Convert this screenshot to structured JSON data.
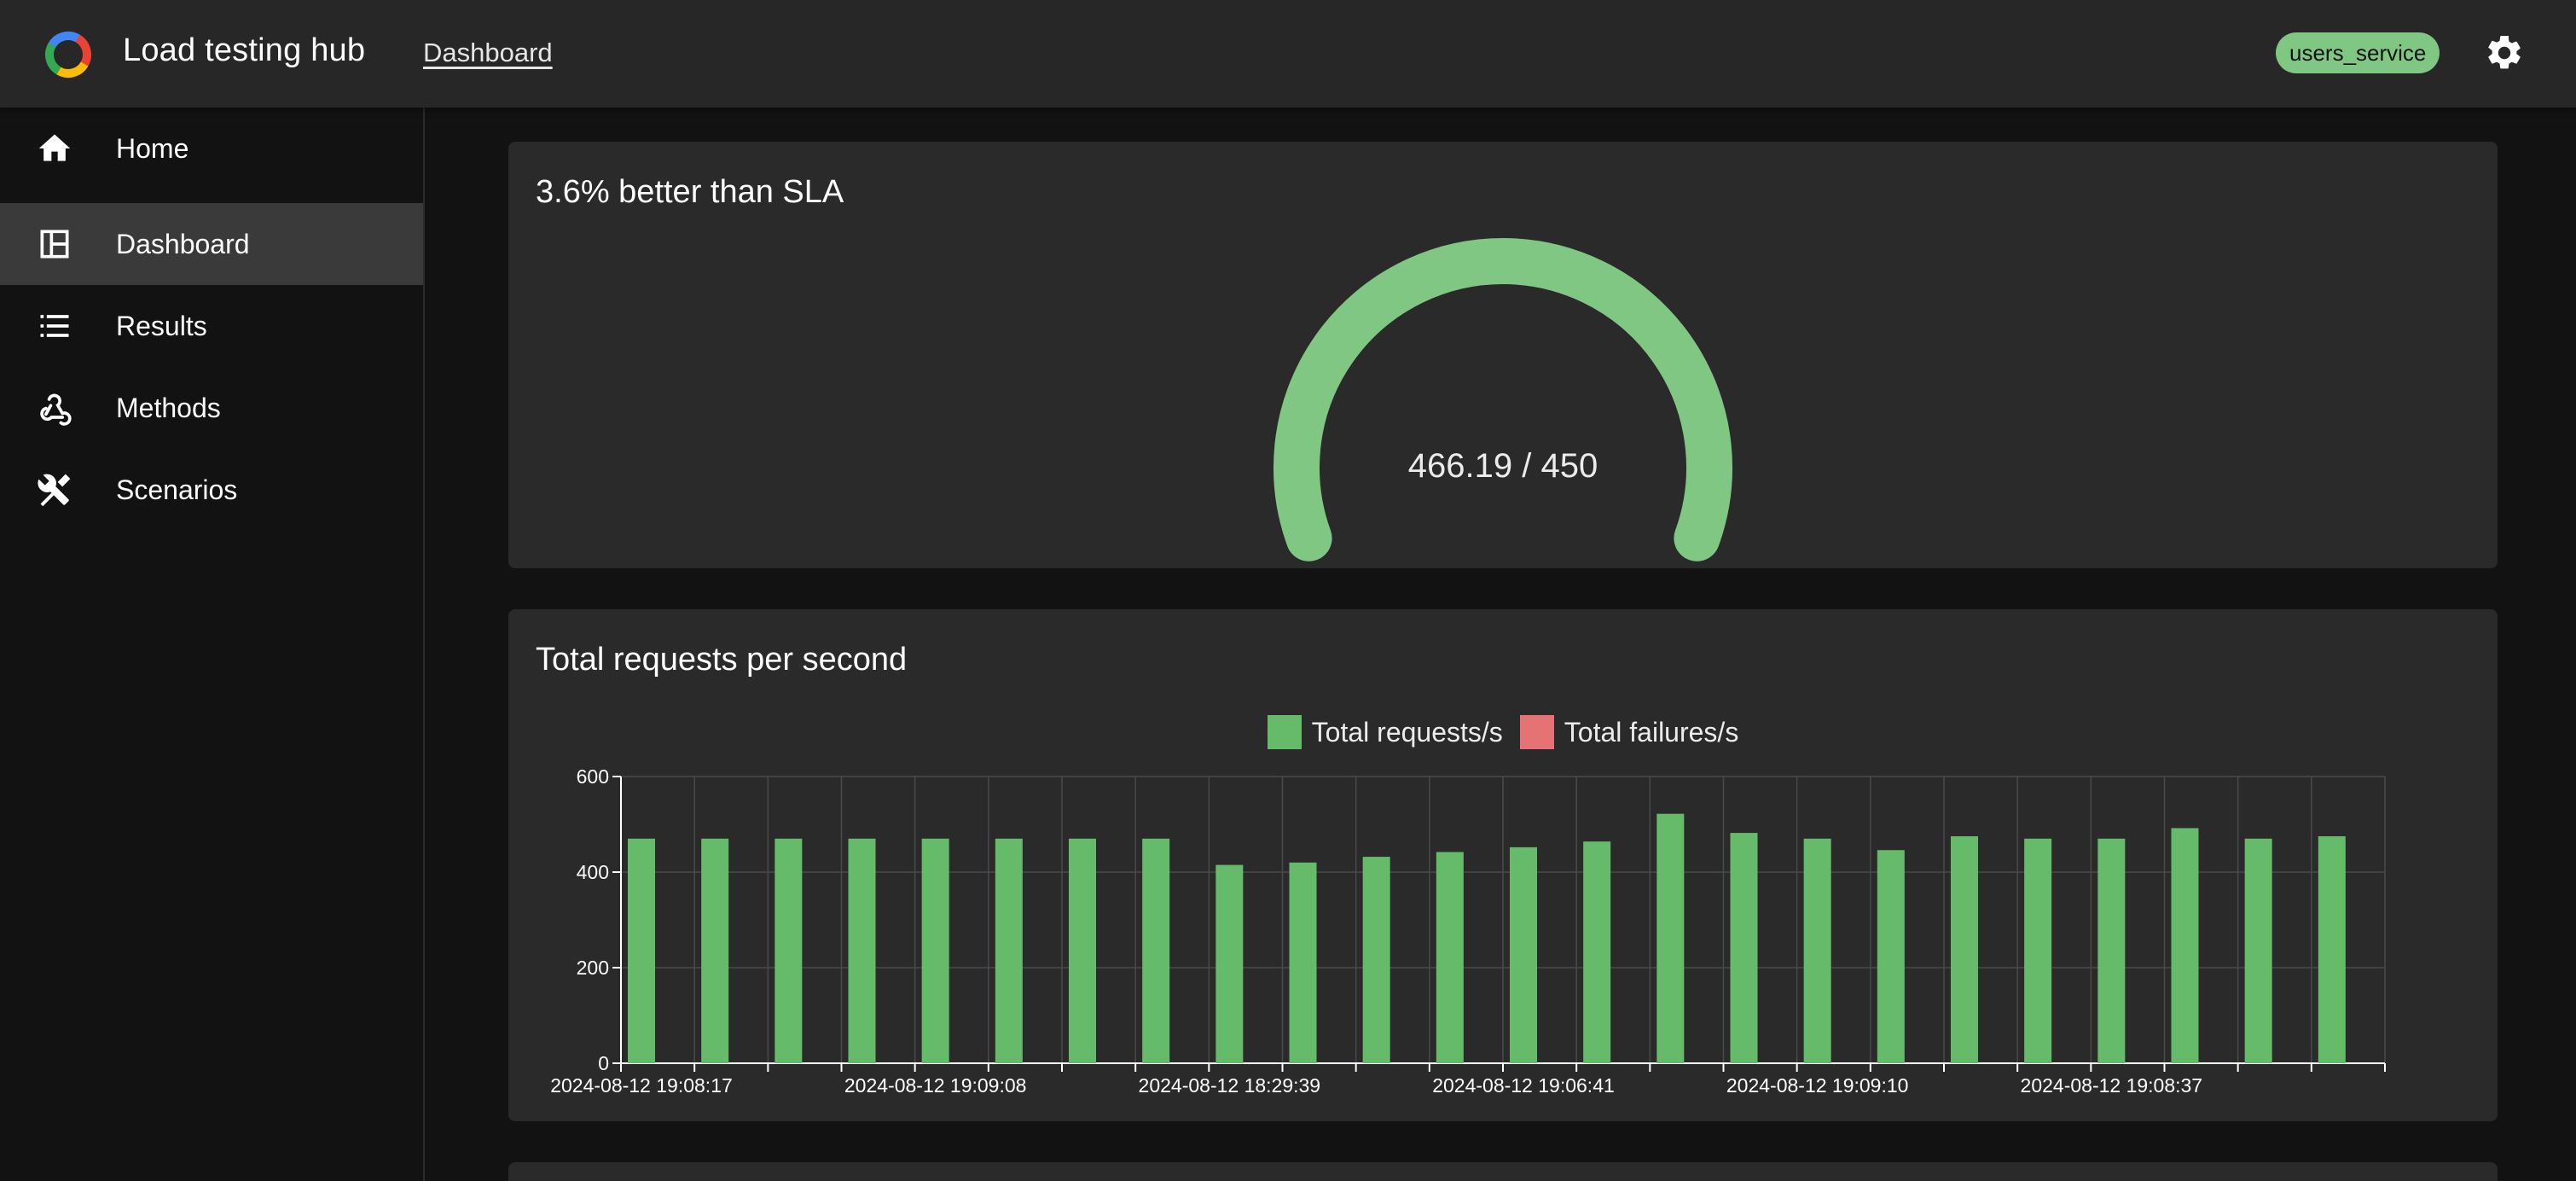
{
  "header": {
    "app_title": "Load testing hub",
    "breadcrumb": "Dashboard",
    "service_badge": "users_service",
    "logo_icon": "google-colors-ring-icon",
    "settings_icon": "gear-icon"
  },
  "sidebar": {
    "items": [
      {
        "label": "Home",
        "icon": "home-icon",
        "active": false
      },
      {
        "label": "Dashboard",
        "icon": "dashboard-icon",
        "active": true
      },
      {
        "label": "Results",
        "icon": "list-icon",
        "active": false
      },
      {
        "label": "Methods",
        "icon": "webhook-icon",
        "active": false
      },
      {
        "label": "Scenarios",
        "icon": "tools-icon",
        "active": false
      }
    ]
  },
  "sla_card": {
    "title": "3.6% better than SLA",
    "value_text": "466.19 / 450",
    "value": 466.19,
    "target": 450,
    "color": "#81c784"
  },
  "rps_card": {
    "title": "Total requests per second",
    "legend": [
      {
        "label": "Total requests/s",
        "color": "#66bb6a"
      },
      {
        "label": "Total failures/s",
        "color": "#e57373"
      }
    ]
  },
  "chart_data": {
    "type": "bar",
    "title": "Total requests per second",
    "ylim": [
      0,
      600
    ],
    "yticks": [
      0,
      200,
      400,
      600
    ],
    "grid": true,
    "legend_position": "top-center",
    "x_tick_labels": [
      "2024-08-12 19:08:17",
      "2024-08-12 19:09:08",
      "2024-08-12 18:29:39",
      "2024-08-12 19:06:41",
      "2024-08-12 19:09:10",
      "2024-08-12 19:08:37"
    ],
    "x_tick_label_every": 4,
    "series": [
      {
        "name": "Total requests/s",
        "color": "#66bb6a",
        "values": [
          470,
          470,
          470,
          470,
          470,
          470,
          470,
          470,
          415,
          420,
          432,
          442,
          452,
          464,
          522,
          482,
          470,
          446,
          475,
          470,
          470,
          492,
          470,
          475
        ]
      },
      {
        "name": "Total failures/s",
        "color": "#e57373",
        "values": [
          0,
          0,
          0,
          0,
          0,
          0,
          0,
          0,
          0,
          0,
          0,
          0,
          0,
          0,
          0,
          0,
          0,
          0,
          0,
          0,
          0,
          0,
          0,
          0
        ]
      }
    ]
  }
}
